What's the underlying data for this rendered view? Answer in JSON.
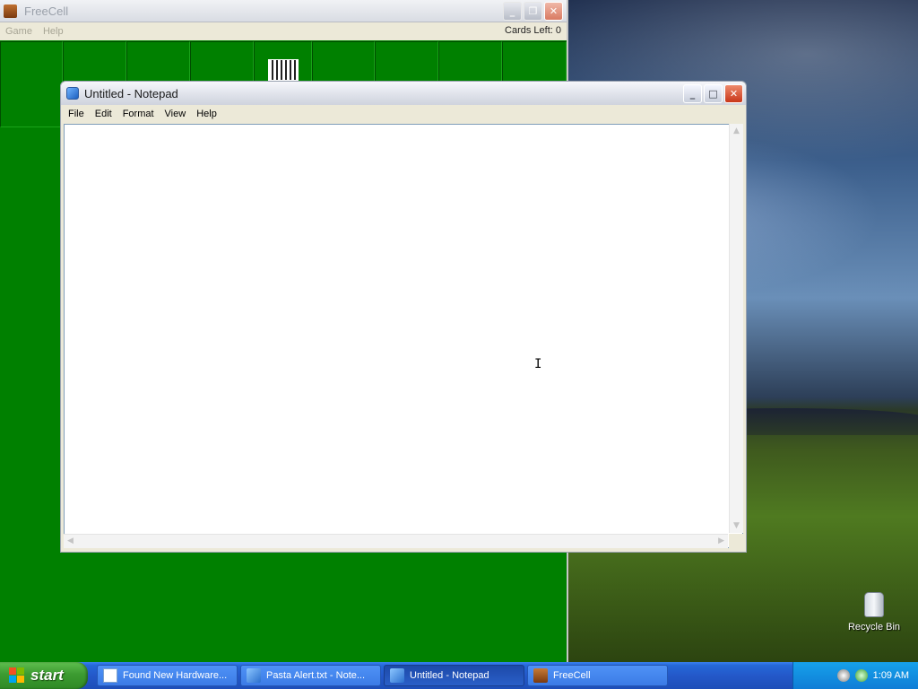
{
  "freecell": {
    "title": "FreeCell",
    "menu": [
      "Game",
      "Help"
    ],
    "cards_left": "Cards Left: 0"
  },
  "notepad": {
    "title": "Untitled - Notepad",
    "menu": [
      "File",
      "Edit",
      "Format",
      "View",
      "Help"
    ],
    "text": ""
  },
  "desktop": {
    "recycle_bin": "Recycle Bin"
  },
  "taskbar": {
    "start_label": "start",
    "tasks": [
      {
        "label": "Found New Hardware...",
        "icon": "hardware-icon"
      },
      {
        "label": "Pasta Alert.txt - Note...",
        "icon": "notepad-icon"
      },
      {
        "label": "Untitled - Notepad",
        "icon": "notepad-icon",
        "active": true
      },
      {
        "label": "FreeCell",
        "icon": "freecell-icon"
      }
    ],
    "clock": "1:09 AM"
  },
  "colors": {
    "felt_green": "#008000",
    "taskbar_blue": "#2458c9",
    "start_green": "#3c9b31"
  }
}
